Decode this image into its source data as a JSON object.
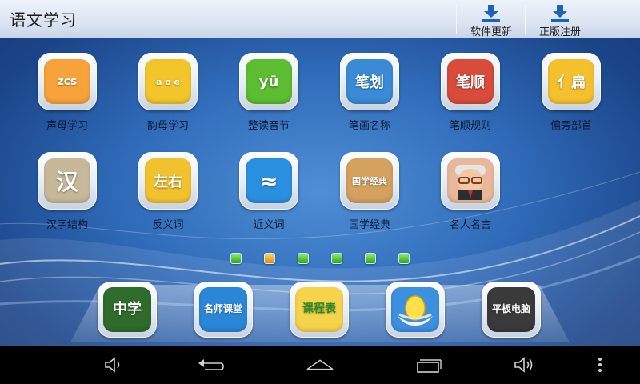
{
  "header": {
    "title": "语文学习",
    "buttons": [
      {
        "label": "软件更新",
        "icon": "download-icon"
      },
      {
        "label": "正版注册",
        "icon": "download-icon"
      }
    ]
  },
  "apps": [
    {
      "label": "声母学习",
      "icon_text": "zcs",
      "icon": "initials-icon",
      "color": "#f7a23a"
    },
    {
      "label": "韵母学习",
      "icon_text": "a o e",
      "icon": "finals-icon",
      "color": "#f2c52a"
    },
    {
      "label": "整读音节",
      "icon_text": "yū",
      "icon": "syllables-icon",
      "color": "#5bbd2f"
    },
    {
      "label": "笔画名称",
      "icon_text": "笔划",
      "icon": "stroke-names-icon",
      "color": "#3a8ad6"
    },
    {
      "label": "笔顺规则",
      "icon_text": "笔顺",
      "icon": "stroke-order-icon",
      "color": "#d94b3b"
    },
    {
      "label": "偏旁部首",
      "icon_text": "亻扁",
      "icon": "radicals-icon",
      "color": "#f5c02e"
    },
    {
      "label": "汉字结构",
      "icon_text": "汉",
      "icon": "character-structure-icon",
      "color": "#c8b89a"
    },
    {
      "label": "反义词",
      "icon_text": "左右",
      "icon": "antonyms-icon",
      "color": "#f2c12e"
    },
    {
      "label": "近义词",
      "icon_text": "≈",
      "icon": "synonyms-icon",
      "color": "#2b8fe0"
    },
    {
      "label": "国学经典",
      "icon_text": "国学经典",
      "icon": "classics-book-icon",
      "color": "#d4a15e"
    },
    {
      "label": "名人名言",
      "icon_text": "",
      "icon": "famous-person-icon",
      "color": "#e9b89a"
    }
  ],
  "pager": {
    "count": 6,
    "active_index": 1
  },
  "dock": [
    {
      "icon_text": "中学",
      "icon": "middle-school-icon",
      "color": "#2f6b2a"
    },
    {
      "icon_text": "名师课堂",
      "icon": "famous-teacher-class-icon",
      "color": "#2a86d6"
    },
    {
      "icon_text": "课程表",
      "icon": "timetable-icon",
      "color": "#f5d34a"
    },
    {
      "icon_text": "",
      "icon": "egg-nest-icon",
      "color": "#3d8fe0"
    },
    {
      "icon_text": "平板电脑",
      "icon": "tablet-pc-icon",
      "color": "#3a3a3a"
    }
  ],
  "navbar": [
    {
      "icon": "volume-down-icon"
    },
    {
      "icon": "back-icon"
    },
    {
      "icon": "home-icon"
    },
    {
      "icon": "recent-apps-icon"
    },
    {
      "icon": "volume-up-icon"
    },
    {
      "icon": "overflow-menu-icon"
    }
  ]
}
